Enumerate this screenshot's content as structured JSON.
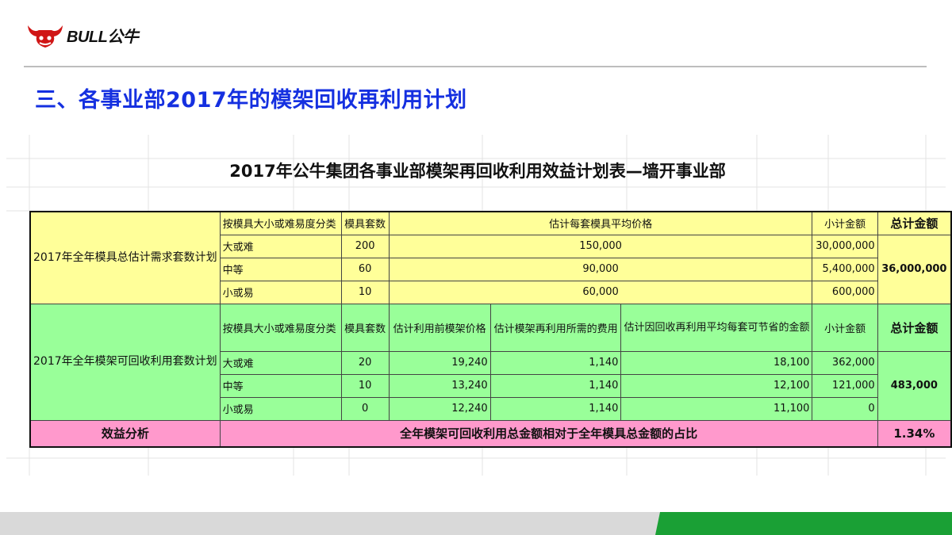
{
  "brand": {
    "logo_text": "BULL公牛",
    "accent": "#d01515"
  },
  "slide_title": "三、各事业部2017年的模架回收再利用计划",
  "table_title": "2017年公牛集团各事业部模架再回收利用效益计划表—墙开事业部",
  "colors": {
    "title_blue": "#1530e0",
    "section1": "#ffff99",
    "section2": "#99ff99",
    "analysis": "#ff99cc",
    "footer_green": "#1aa035"
  },
  "section1": {
    "label": "2017年全年模具总估计需求套数计划",
    "headers": {
      "category": "按模具大小或难易度分类",
      "count": "模具套数",
      "price": "估计每套模具平均价格",
      "subtotal": "小计金额",
      "total": "总计金额"
    },
    "rows": [
      {
        "category": "大或难",
        "count": "200",
        "price": "150,000",
        "subtotal": "30,000,000"
      },
      {
        "category": "中等",
        "count": "60",
        "price": "90,000",
        "subtotal": "5,400,000"
      },
      {
        "category": "小或易",
        "count": "10",
        "price": "60,000",
        "subtotal": "600,000"
      }
    ],
    "total": "36,000,000"
  },
  "section2": {
    "label": "2017年全年模架可回收利用套数计划",
    "headers": {
      "category": "按模具大小或难易度分类",
      "count": "模具套数",
      "price_before": "估计利用前模架价格",
      "reuse_cost": "估计模架再利用所需的费用",
      "saving": "估计因回收再利用平均每套可节省的金额",
      "subtotal": "小计金额",
      "total": "总计金额"
    },
    "rows": [
      {
        "category": "大或难",
        "count": "20",
        "price_before": "19,240",
        "reuse_cost": "1,140",
        "saving": "18,100",
        "subtotal": "362,000"
      },
      {
        "category": "中等",
        "count": "10",
        "price_before": "13,240",
        "reuse_cost": "1,140",
        "saving": "12,100",
        "subtotal": "121,000"
      },
      {
        "category": "小或易",
        "count": "0",
        "price_before": "12,240",
        "reuse_cost": "1,140",
        "saving": "11,100",
        "subtotal": "0"
      }
    ],
    "total": "483,000"
  },
  "analysis": {
    "label": "效益分析",
    "description": "全年模架可回收利用总金额相对于全年模具总金额的占比",
    "value": "1.34%"
  }
}
